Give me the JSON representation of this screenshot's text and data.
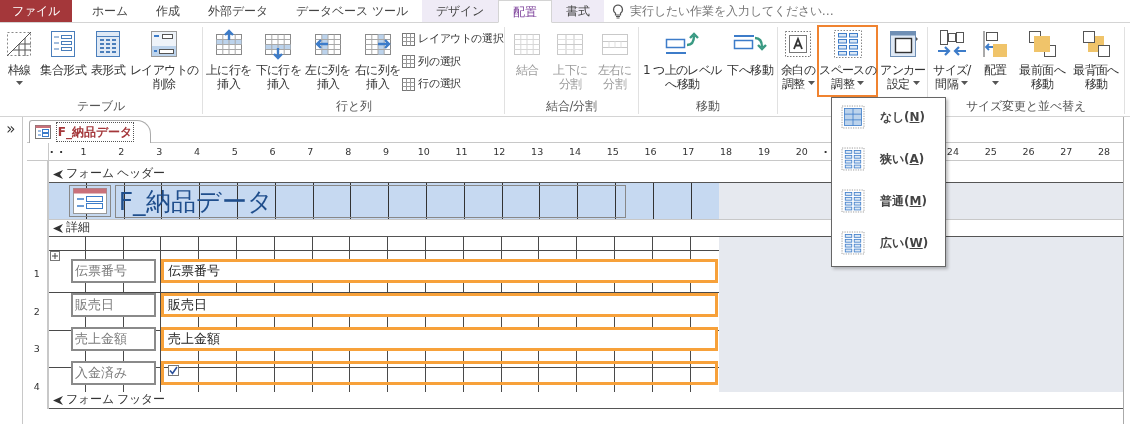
{
  "ribbon_tabs": [
    {
      "label": "ファイル",
      "kind": "file",
      "selected": false
    },
    {
      "label": "ホーム",
      "kind": "standard",
      "selected": false
    },
    {
      "label": "作成",
      "kind": "standard",
      "selected": false
    },
    {
      "label": "外部データ",
      "kind": "standard",
      "selected": false
    },
    {
      "label": "データベース ツール",
      "kind": "standard",
      "selected": false
    },
    {
      "label": "デザイン",
      "kind": "contextual",
      "selected": false
    },
    {
      "label": "配置",
      "kind": "contextual",
      "selected": true
    },
    {
      "label": "書式",
      "kind": "contextual",
      "selected": false
    }
  ],
  "tell_me": {
    "placeholder": "実行したい作業を入力してください…"
  },
  "ribbon_groups": [
    {
      "label": "テーブル",
      "buttons": [
        {
          "lines": [
            "枠線"
          ],
          "dropdown": true,
          "disabled": false,
          "expanded": false
        },
        {
          "lines": [
            "集合形式"
          ],
          "dropdown": false,
          "disabled": false,
          "expanded": false
        },
        {
          "lines": [
            "表形式"
          ],
          "dropdown": false,
          "disabled": false,
          "expanded": false
        },
        {
          "lines": [
            "レイアウトの",
            "削除"
          ],
          "dropdown": false,
          "disabled": false,
          "expanded": false
        }
      ]
    },
    {
      "label": "行と列",
      "buttons": [
        {
          "lines": [
            "上に行を",
            "挿入"
          ],
          "dropdown": false,
          "disabled": false,
          "expanded": false
        },
        {
          "lines": [
            "下に行を",
            "挿入"
          ],
          "dropdown": false,
          "disabled": false,
          "expanded": false
        },
        {
          "lines": [
            "左に列を",
            "挿入"
          ],
          "dropdown": false,
          "disabled": false,
          "expanded": false
        },
        {
          "lines": [
            "右に列を",
            "挿入"
          ],
          "dropdown": false,
          "disabled": false,
          "expanded": false
        }
      ],
      "small_buttons": [
        {
          "label": "レイアウトの選択"
        },
        {
          "label": "列の選択"
        },
        {
          "label": "行の選択"
        }
      ]
    },
    {
      "label": "結合/分割",
      "buttons": [
        {
          "lines": [
            "結合"
          ],
          "dropdown": false,
          "disabled": true,
          "expanded": false
        },
        {
          "lines": [
            "上下に",
            "分割"
          ],
          "dropdown": false,
          "disabled": true,
          "expanded": false
        },
        {
          "lines": [
            "左右に",
            "分割"
          ],
          "dropdown": false,
          "disabled": true,
          "expanded": false
        }
      ]
    },
    {
      "label": "移動",
      "buttons": [
        {
          "lines": [
            "1 つ上のレベル",
            "へ移動"
          ],
          "dropdown": false,
          "disabled": false,
          "expanded": false
        },
        {
          "lines": [
            "下へ移動"
          ],
          "dropdown": false,
          "disabled": false,
          "expanded": false
        }
      ]
    },
    {
      "buttons": [
        {
          "lines": [
            "余白の",
            "調整"
          ],
          "dropdown": true,
          "disabled": false,
          "expanded": false
        },
        {
          "lines": [
            "スペースの",
            "調整"
          ],
          "dropdown": true,
          "disabled": false,
          "expanded": true
        },
        {
          "lines": [
            "アンカー",
            "設定"
          ],
          "dropdown": true,
          "disabled": false,
          "expanded": false
        }
      ]
    },
    {
      "label": "サイズ変更と並べ替え",
      "buttons": [
        {
          "lines": [
            "サイズ/",
            "間隔"
          ],
          "dropdown": true,
          "disabled": false,
          "expanded": false
        },
        {
          "lines": [
            "配置"
          ],
          "dropdown": true,
          "disabled": false,
          "expanded": false
        },
        {
          "lines": [
            "最前面へ",
            "移動"
          ],
          "dropdown": false,
          "disabled": false,
          "expanded": false
        },
        {
          "lines": [
            "最背面へ",
            "移動"
          ],
          "dropdown": false,
          "disabled": false,
          "expanded": false
        }
      ]
    }
  ],
  "space_menu": {
    "items": [
      {
        "text": "なし(",
        "access_key": "N",
        "closing": ")"
      },
      {
        "text": "狭い(",
        "access_key": "A",
        "closing": ")"
      },
      {
        "text": "普通(",
        "access_key": "M",
        "closing": ")"
      },
      {
        "text": "広い(",
        "access_key": "W",
        "closing": ")"
      }
    ]
  },
  "navigation_pane": {
    "toggle": "»"
  },
  "document_tab": {
    "label": "F_納品データ",
    "selected": true
  },
  "ruler": {
    "left_numbers": [
      "1",
      "2",
      "3",
      "4",
      "5",
      "6",
      "7",
      "8",
      "9",
      "10",
      "11",
      "12",
      "13",
      "14",
      "15",
      "16",
      "17",
      "18",
      "19",
      "20"
    ],
    "right_numbers": [
      "24",
      "25",
      "26",
      "27",
      "28"
    ]
  },
  "vertical_ruler": {
    "numbers": [
      "1",
      "2",
      "3",
      "4"
    ]
  },
  "form": {
    "header": {
      "label": "フォーム ヘッダー",
      "title": "F_納品データ"
    },
    "detail": {
      "label": "詳細",
      "rows": [
        {
          "label": "伝票番号",
          "kind": "textbox",
          "value": "伝票番号",
          "selected": true
        },
        {
          "label": "販売日",
          "kind": "textbox",
          "value": "販売日",
          "selected": true
        },
        {
          "label": "売上金額",
          "kind": "textbox",
          "value": "売上金額",
          "selected": true
        },
        {
          "label": "入金済み",
          "kind": "checkbox",
          "checked": true,
          "selected": true
        }
      ]
    },
    "footer": {
      "label": "フォーム フッター"
    }
  }
}
